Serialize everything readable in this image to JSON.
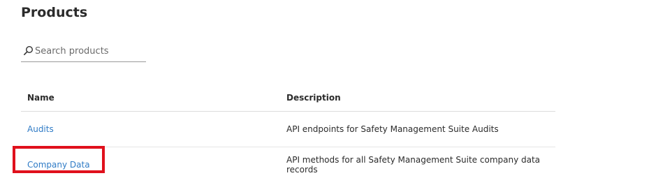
{
  "page": {
    "title": "Products"
  },
  "search": {
    "placeholder": "Search products",
    "value": "",
    "icon": "search-icon"
  },
  "table": {
    "headers": {
      "name": "Name",
      "description": "Description"
    },
    "rows": [
      {
        "name": "Audits",
        "description": "API endpoints for Safety Management Suite Audits"
      },
      {
        "name": "Company Data",
        "description": "API methods for all Safety Management Suite company data records"
      }
    ]
  },
  "annotation": {
    "highlight_color": "#e0101c",
    "highlighted_item": "Company Data"
  },
  "colors": {
    "link": "#2f7bc6",
    "heading": "#2b2b2b"
  }
}
